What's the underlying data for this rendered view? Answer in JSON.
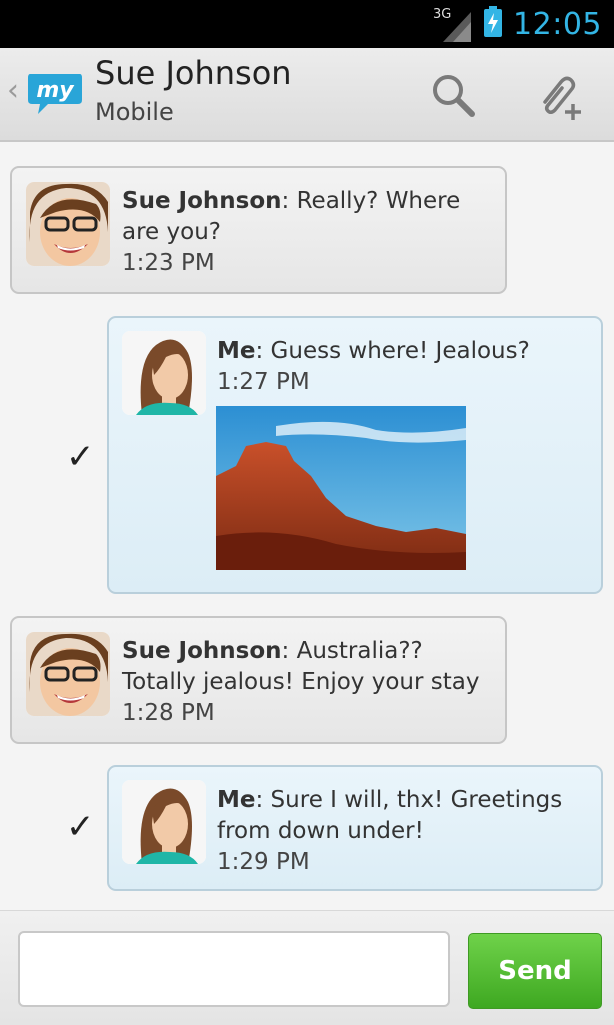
{
  "status_bar": {
    "network": "3G",
    "time": "12:05"
  },
  "header": {
    "title": "Sue Johnson",
    "subtitle": "Mobile",
    "logo_text": "my"
  },
  "messages": [
    {
      "sender": "Sue Johnson",
      "text": ": Really? Where are you?",
      "time": "1:23 PM",
      "outgoing": false
    },
    {
      "sender": "Me",
      "text": ": Guess where! Jealous?",
      "time": "1:27 PM",
      "outgoing": true,
      "has_photo": true
    },
    {
      "sender": "Sue Johnson",
      "text": ": Australia?? Totally jealous! Enjoy your stay",
      "time": "1:28 PM",
      "outgoing": false
    },
    {
      "sender": "Me",
      "text": ": Sure I will, thx! Greetings from down under!",
      "time": "1:29 PM",
      "outgoing": true
    }
  ],
  "composer": {
    "value": "",
    "placeholder": "",
    "send_label": "Send"
  },
  "colors": {
    "accent": "#33b5e5",
    "send_green": "#4cb82c",
    "outgoing_bubble": "#dcedf6"
  }
}
